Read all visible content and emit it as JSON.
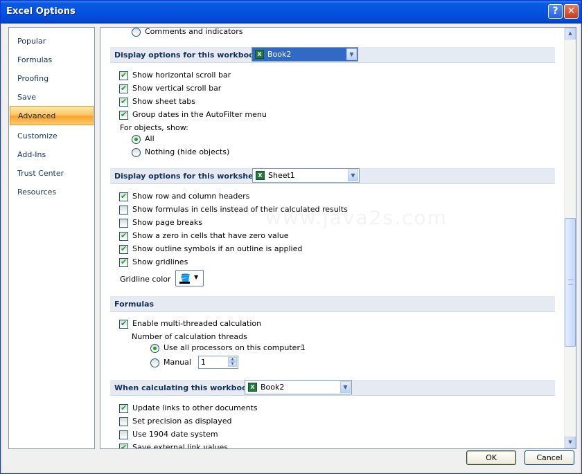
{
  "window": {
    "title": "Excel Options",
    "help_glyph": "?",
    "close_glyph": "✕"
  },
  "nav": {
    "items": [
      "Popular",
      "Formulas",
      "Proofing",
      "Save",
      "Advanced",
      "Customize",
      "Add-Ins",
      "Trust Center",
      "Resources"
    ],
    "selected": "Advanced"
  },
  "top": {
    "comments_label": "Comments and indicators"
  },
  "workbook_display": {
    "header": "Display options for this workbook:",
    "combo_value": "Book2",
    "options": [
      {
        "label": "Show horizontal scroll bar",
        "checked": true
      },
      {
        "label": "Show vertical scroll bar",
        "checked": true
      },
      {
        "label": "Show sheet tabs",
        "checked": true
      },
      {
        "label": "Group dates in the AutoFilter menu",
        "checked": true
      }
    ],
    "objects_label": "For objects, show:",
    "objects_options": [
      {
        "label": "All",
        "checked": true
      },
      {
        "label": "Nothing (hide objects)",
        "checked": false
      }
    ]
  },
  "worksheet_display": {
    "header": "Display options for this worksheet:",
    "combo_value": "Sheet1",
    "options": [
      {
        "label": "Show row and column headers",
        "checked": true
      },
      {
        "label": "Show formulas in cells instead of their calculated results",
        "checked": false
      },
      {
        "label": "Show page breaks",
        "checked": false
      },
      {
        "label": "Show a zero in cells that have zero value",
        "checked": true
      },
      {
        "label": "Show outline symbols if an outline is applied",
        "checked": true
      },
      {
        "label": "Show gridlines",
        "checked": true
      }
    ],
    "gridline_label": "Gridline color"
  },
  "formulas": {
    "header": "Formulas",
    "multithread_label": "Enable multi-threaded calculation",
    "multithread_checked": true,
    "threads_label": "Number of calculation threads",
    "use_all_label": "Use all processors on this computer:",
    "processor_count": "1",
    "manual_label": "Manual",
    "manual_value": "1"
  },
  "calculating": {
    "header": "When calculating this workbook:",
    "combo_value": "Book2",
    "options": [
      {
        "label": "Update links to other documents",
        "checked": true
      },
      {
        "label": "Set precision as displayed",
        "checked": false
      },
      {
        "label": "Use 1904 date system",
        "checked": false
      },
      {
        "label": "Save external link values",
        "checked": true
      }
    ]
  },
  "watermark": "www.java2s.com",
  "buttons": {
    "ok": "OK",
    "cancel": "Cancel"
  }
}
